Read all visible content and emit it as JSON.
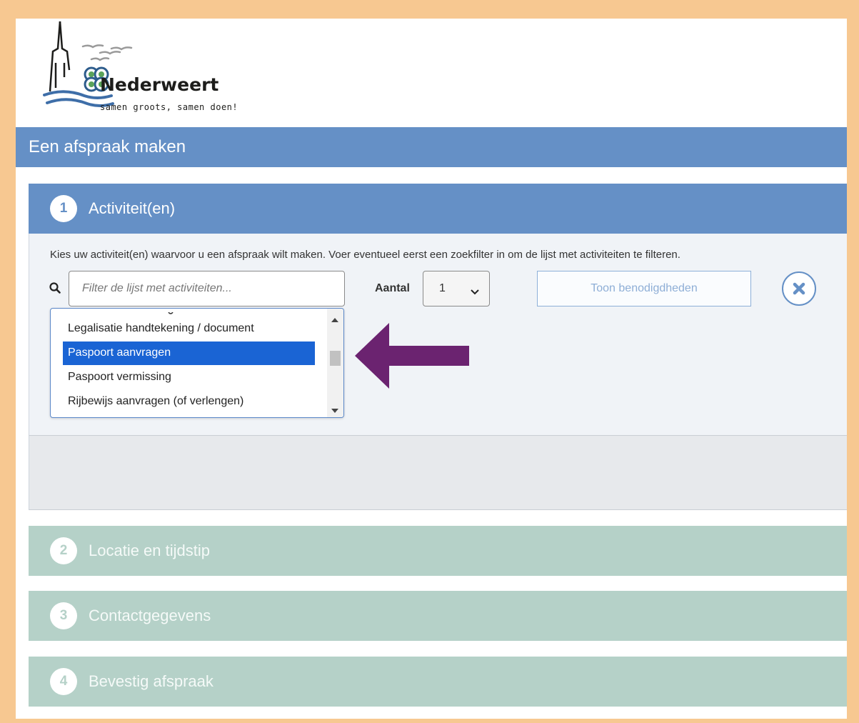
{
  "brand": {
    "name": "Nederweert",
    "tagline": "samen groots, samen doen!"
  },
  "header": {
    "title": "Een afspraak maken"
  },
  "steps": [
    {
      "number": "1",
      "label": "Activiteit(en)",
      "active": true
    },
    {
      "number": "2",
      "label": "Locatie en tijdstip",
      "active": false
    },
    {
      "number": "3",
      "label": "Contactgegevens",
      "active": false
    },
    {
      "number": "4",
      "label": "Bevestig afspraak",
      "active": false
    }
  ],
  "activity": {
    "instruction": "Kies uw activiteit(en) waarvoor u een afspraak wilt maken. Voer eventueel eerst een zoekfilter in om de lijst met activiteiten te filteren.",
    "filter_placeholder": "Filter de lijst met activiteiten...",
    "filter_value": "",
    "aantal_label": "Aantal",
    "aantal_value": "1",
    "toon_button": "Toon benodigdheden",
    "list_items": [
      {
        "label": "Legalisatie handtekening / document",
        "selected": false
      },
      {
        "label": "Paspoort aanvragen",
        "selected": true
      },
      {
        "label": "Paspoort vermissing",
        "selected": false
      },
      {
        "label": "Rijbewijs aanvragen (of verlengen)",
        "selected": false
      }
    ]
  },
  "colors": {
    "primary_blue": "#6590c6",
    "inactive_green": "#b5d1c8",
    "selection_blue": "#1a64d4",
    "arrow_purple": "#6b2370",
    "frame_orange": "#f7c891"
  },
  "icons": {
    "search": "search-icon",
    "close": "close-circle-icon",
    "chevron": "chevron-down-icon",
    "arrow": "arrow-left-icon"
  }
}
